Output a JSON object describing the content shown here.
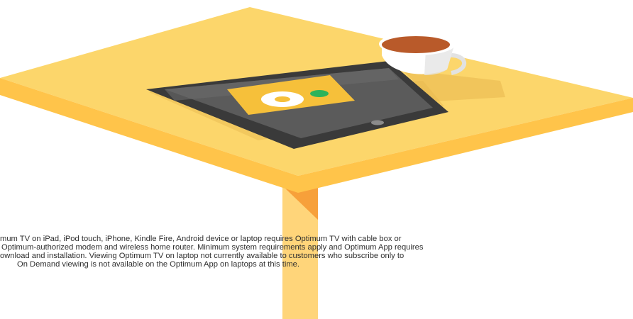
{
  "illustration": {
    "subject": "tabletop-with-tablet-and-coffee-cup",
    "icons": [
      "tablet-icon",
      "coffee-cup-icon",
      "play-icon"
    ]
  },
  "colors": {
    "table_top": "#FCD66B",
    "table_edge": "#FFC44A",
    "table_leg": "#FFD57A",
    "table_leg_shadow": "#F7A03A",
    "tablet_body": "#3A3A3A",
    "tablet_screen": "#5B5B5B",
    "screen_tile": "#F6C03A",
    "cup_white": "#FFFFFF",
    "coffee": "#B95A2A",
    "green_indicator": "#2CB35B",
    "text": "#2F2F2F",
    "background": "#FFFFFF"
  },
  "disclaimer": {
    "lines": [
      "mum TV on iPad, iPod touch, iPhone, Kindle Fire, Android device or laptop requires Optimum TV with cable box or",
      "Optimum-authorized modem and wireless home router. Minimum system requirements apply and Optimum App requires",
      "ownload and installation. Viewing Optimum TV on laptop not currently available to customers who subscribe only to",
      "On Demand viewing is not available on the Optimum App on laptops at this time."
    ]
  }
}
